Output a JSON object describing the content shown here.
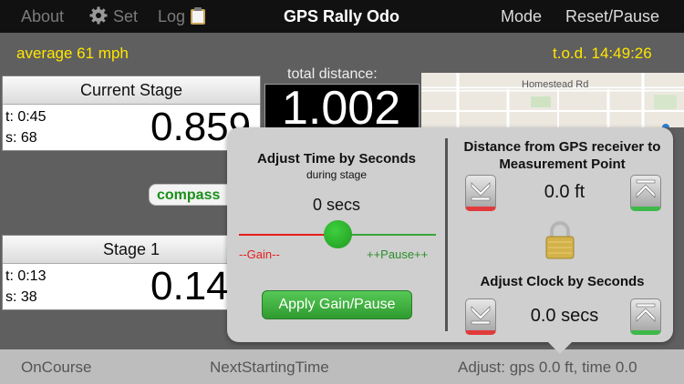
{
  "topbar": {
    "about": "About",
    "set": "Set",
    "log": "Log",
    "title": "GPS Rally Odo",
    "mode": "Mode",
    "reset_pause": "Reset/Pause"
  },
  "status": {
    "average": "average 61 mph",
    "tod": "t.o.d. 14:49:26"
  },
  "current_stage": {
    "title": "Current Stage",
    "t": "t: 0:45",
    "s": "s: 68",
    "distance": "0.859"
  },
  "stage1": {
    "title": "Stage 1",
    "t": "t: 0:13",
    "s": "s: 38",
    "distance": "0.14"
  },
  "total": {
    "label": "total distance:",
    "value": "1.002"
  },
  "map": {
    "street": "Homestead Rd"
  },
  "compass": {
    "label": "compass"
  },
  "popup": {
    "time_title": "Adjust Time by Seconds",
    "time_subtitle": "during stage",
    "time_value": "0 secs",
    "slider_position": 0.5,
    "gain_label": "--Gain--",
    "pause_label": "++Pause++",
    "apply_label": "Apply Gain/Pause",
    "distance_title": "Distance from GPS receiver to Measurement Point",
    "distance_value": "0.0 ft",
    "clock_title": "Adjust Clock by Seconds",
    "clock_value": "0.0 secs"
  },
  "bottombar": {
    "oncourse": "OnCourse",
    "next_starting": "NextStartingTime",
    "adjust_status": "Adjust: gps 0.0 ft, time 0.0"
  },
  "colors": {
    "status_yellow": "#ffe600",
    "slider_red": "#e31d1d",
    "slider_green": "#37a537",
    "apply_green": "#2f9b2f"
  }
}
